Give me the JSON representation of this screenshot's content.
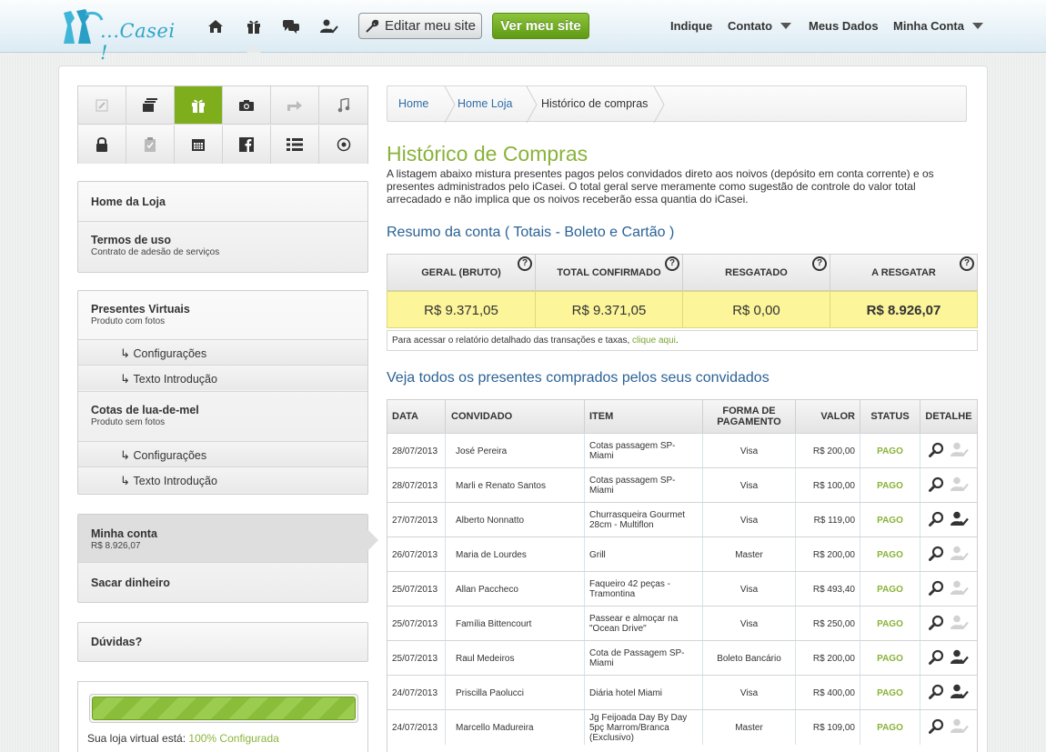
{
  "header": {
    "logo_text": "...Casei !",
    "edit_button": "Editar meu site",
    "view_button": "Ver meu site",
    "nav": {
      "indique": "Indique",
      "contato": "Contato",
      "meus_dados": "Meus Dados",
      "minha_conta": "Minha Conta"
    },
    "nav_icons": [
      "home-icon",
      "gift-icon",
      "chat-icon",
      "user-check-icon"
    ]
  },
  "sidebar": {
    "icon_grid": [
      "edit-icon",
      "pages-icon",
      "gift-icon",
      "camera-icon",
      "share-icon",
      "music-icon",
      "lock-icon",
      "checklist-icon",
      "calendar-icon",
      "facebook-icon",
      "list-icon",
      "target-icon"
    ],
    "home_loja": "Home da Loja",
    "termos_title": "Termos de uso",
    "termos_sub": "Contrato de adesão de serviços",
    "presentes_title": "Presentes Virtuais",
    "presentes_sub": "Produto com fotos",
    "presentes_children": [
      "Configurações",
      "Texto Introdução"
    ],
    "cotas_title": "Cotas de lua-de-mel",
    "cotas_sub": "Produto sem fotos",
    "cotas_children": [
      "Configurações",
      "Texto Introdução"
    ],
    "minha_conta_title": "Minha conta",
    "minha_conta_value": "R$ 8.926,07",
    "sacar": "Sacar dinheiro",
    "duvidas": "Dúvidas?",
    "progress_label": "Sua loja virtual está:",
    "progress_value": "100% Configurada",
    "progress_fraction": 1.0
  },
  "breadcrumb": [
    "Home",
    "Home Loja",
    "Histórico de compras"
  ],
  "main": {
    "title": "Histórico de Compras",
    "intro": "A listagem abaixo mistura presentes pagos pelos convidados direto aos noivos (depósito em conta corrente) e os presentes administrados pelo iCasei. O total geral serve meramente como sugestão de controle do valor total arrecadado e não implica que os noivos receberão essa quantia do iCasei.",
    "summary_title": "Resumo da conta ( Totais - Boleto e Cartão )",
    "summary": [
      {
        "label": "GERAL (BRUTO)",
        "value": "R$ 9.371,05"
      },
      {
        "label": "TOTAL CONFIRMADO",
        "value": "R$ 9.371,05"
      },
      {
        "label": "RESGATADO",
        "value": "R$ 0,00"
      },
      {
        "label": "A RESGATAR",
        "value": "R$ 8.926,07"
      }
    ],
    "summary_note": "Para acessar o relatório detalhado das transações e taxas,",
    "summary_link": "clique aqui",
    "summary_note_end": ".",
    "list_title": "Veja todos os presentes comprados pelos seus convidados",
    "columns": [
      "DATA",
      "CONVIDADO",
      "ITEM",
      "FORMA DE PAGAMENTO",
      "VALOR",
      "STATUS",
      "DETALHE"
    ],
    "rows": [
      {
        "data": "28/07/2013",
        "convidado": "José Pereira",
        "item": "Cotas passagem SP-Miami",
        "forma": "Visa",
        "valor": "R$ 200,00",
        "status": "PAGO",
        "confirmed": false
      },
      {
        "data": "28/07/2013",
        "convidado": "Marli e Renato Santos",
        "item": "Cotas passagem SP-Miami",
        "forma": "Visa",
        "valor": "R$ 100,00",
        "status": "PAGO",
        "confirmed": false
      },
      {
        "data": "27/07/2013",
        "convidado": "Alberto Nonnatto",
        "item": "Churrasqueira Gourmet 28cm - Multiflon",
        "forma": "Visa",
        "valor": "R$ 119,00",
        "status": "PAGO",
        "confirmed": true
      },
      {
        "data": "26/07/2013",
        "convidado": "Maria de Lourdes",
        "item": "Grill",
        "forma": "Master",
        "valor": "R$ 200,00",
        "status": "PAGO",
        "confirmed": false
      },
      {
        "data": "25/07/2013",
        "convidado": "Allan Paccheco",
        "item": "Faqueiro 42 peças - Tramontina",
        "forma": "Visa",
        "valor": "R$ 493,40",
        "status": "PAGO",
        "confirmed": false
      },
      {
        "data": "25/07/2013",
        "convidado": "Família Bittencourt",
        "item": "Passear e almoçar na \"Ocean Drive\"",
        "forma": "Visa",
        "valor": "R$ 250,00",
        "status": "PAGO",
        "confirmed": false
      },
      {
        "data": "25/07/2013",
        "convidado": "Raul Medeiros",
        "item": "Cota de Passagem SP-Miami",
        "forma": "Boleto Bancário",
        "valor": "R$ 200,00",
        "status": "PAGO",
        "confirmed": true
      },
      {
        "data": "24/07/2013",
        "convidado": "Priscilla Paolucci",
        "item": "Diária hotel Miami",
        "forma": "Visa",
        "valor": "R$ 400,00",
        "status": "PAGO",
        "confirmed": true
      },
      {
        "data": "24/07/2013",
        "convidado": "Marcello Madureira",
        "item": "Jg Feijoada Day By Day 5pç Marrom/Branca (Exclusivo)",
        "forma": "Master",
        "valor": "R$ 109,00",
        "status": "PAGO",
        "confirmed": false
      }
    ]
  },
  "colors": {
    "accent_green": "#8ab23a",
    "link_blue": "#2a6296",
    "summary_yellow": "#fcf59a"
  }
}
